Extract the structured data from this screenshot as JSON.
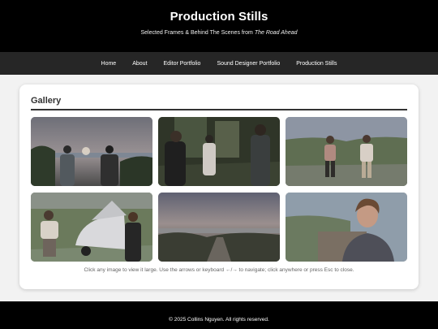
{
  "header": {
    "title": "Production Stills",
    "subtitle_prefix": "Selected Frames & Behind The Scenes from ",
    "subtitle_film": "The Road Ahead"
  },
  "nav": {
    "items": [
      {
        "label": "Home"
      },
      {
        "label": "About"
      },
      {
        "label": "Editor Portfolio"
      },
      {
        "label": "Sound Designer Portfolio"
      },
      {
        "label": "Production Stills"
      }
    ]
  },
  "gallery": {
    "title": "Gallery",
    "hint": "Click any image to view it large. Use the arrows or keyboard ←/→ to navigate; click anywhere or press Esc to close."
  },
  "footer": {
    "text": "© 2025 Collins Nguyen. All rights reserved."
  }
}
